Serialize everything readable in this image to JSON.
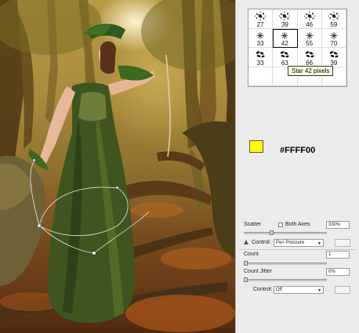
{
  "brush_presets": [
    {
      "size": "27",
      "icon": "splatter-brush-icon"
    },
    {
      "size": "39",
      "icon": "splatter-brush-icon"
    },
    {
      "size": "46",
      "icon": "splatter-brush-icon"
    },
    {
      "size": "59",
      "icon": "splatter-brush-icon"
    },
    {
      "size": "33",
      "icon": "star-brush-icon"
    },
    {
      "size": "42",
      "icon": "star-brush-icon"
    },
    {
      "size": "55",
      "icon": "star-brush-icon"
    },
    {
      "size": "70",
      "icon": "star-brush-icon"
    },
    {
      "size": "33",
      "icon": "leaf-brush-icon"
    },
    {
      "size": "63",
      "icon": "leaf-brush-icon"
    },
    {
      "size": "66",
      "icon": "leaf-brush-icon"
    },
    {
      "size": "39",
      "icon": "leaf-brush-icon"
    }
  ],
  "selected_brush_index": 5,
  "tooltip": "Star 42 pixels",
  "foreground_color": "#FFFF00",
  "background_color": "#000000",
  "color_hex_label": "#FFFF00",
  "scattering": {
    "scatter_label": "Scatter",
    "both_axes_label": "Both Axes",
    "both_axes_checked": false,
    "scatter_value": "330%",
    "scatter_slider_fraction": 0.33,
    "control_label": "Control:",
    "control_value": "Pen Pressure",
    "count_label": "Count",
    "count_value": "1",
    "count_slider_fraction": 0.0,
    "count_jitter_label": "Count Jitter",
    "count_jitter_value": "0%",
    "count_jitter_slider_fraction": 0.0,
    "control2_label": "Control:",
    "control2_value": "Off"
  }
}
